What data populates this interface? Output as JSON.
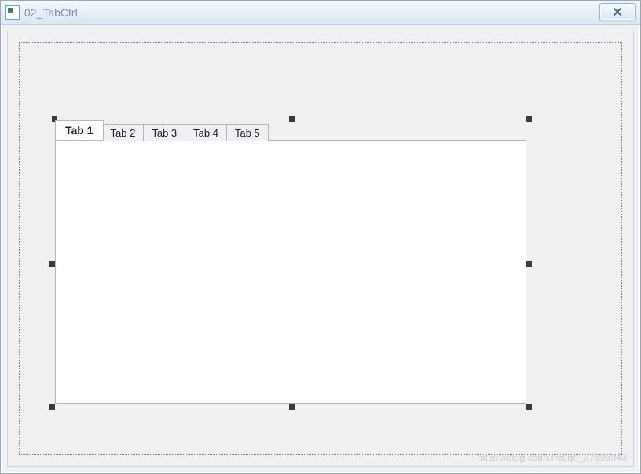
{
  "window": {
    "title": "02_TabCtrl"
  },
  "tabs": [
    {
      "label": "Tab 1",
      "active": true
    },
    {
      "label": "Tab 2",
      "active": false
    },
    {
      "label": "Tab 3",
      "active": false
    },
    {
      "label": "Tab 4",
      "active": false
    },
    {
      "label": "Tab 5",
      "active": false
    }
  ],
  "watermark": "https://blog.csdn.net/qq_37596943"
}
